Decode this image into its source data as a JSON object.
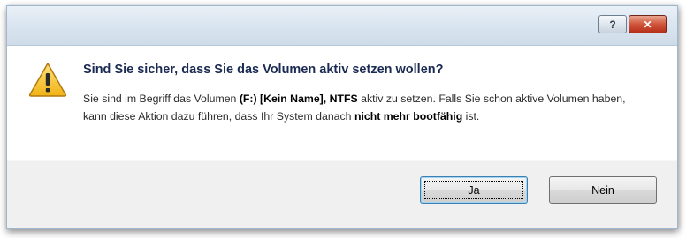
{
  "dialog": {
    "title_buttons": {
      "help_label": "?",
      "close_label": "✕"
    },
    "icon": "warning-triangle-icon",
    "headline": "Sind Sie sicher, dass Sie das Volumen aktiv setzen wollen?",
    "message": {
      "part1": "Sie sind im Begriff das Volumen ",
      "volume": "(F:) [Kein Name]",
      "sep": ", ",
      "fs": "NTFS",
      "part2": " aktiv zu setzen. Falls Sie schon aktive Volumen haben, kann diese Aktion dazu führen, dass Ihr System danach ",
      "emphasis": "nicht mehr bootfähig",
      "part3": " ist."
    },
    "buttons": {
      "yes_label": "Ja",
      "no_label": "Nein"
    }
  },
  "colors": {
    "headline": "#1a2a52",
    "warning_fill": "#f5c22b",
    "close_button": "#c8462c"
  }
}
